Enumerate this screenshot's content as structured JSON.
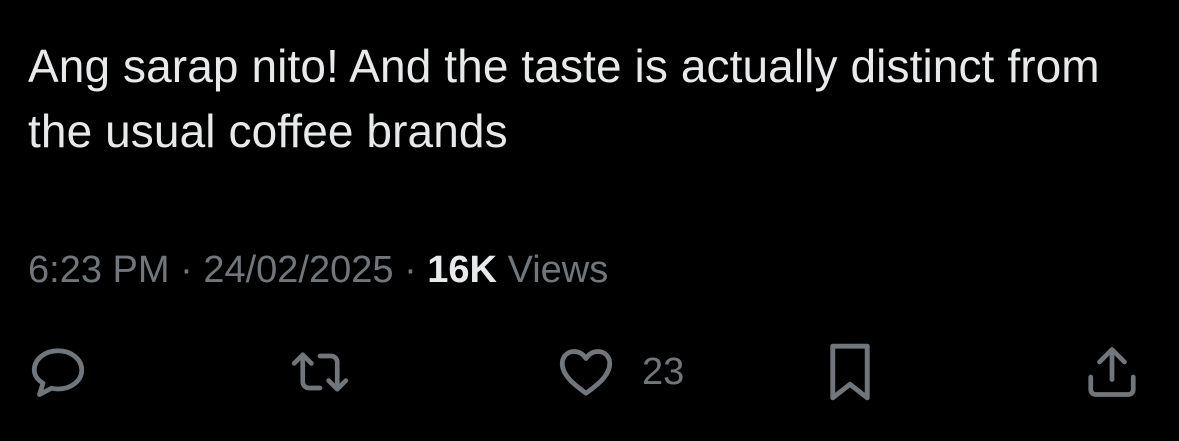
{
  "tweet": {
    "text": "Ang sarap nito! And the taste is actually distinct from the usual coffee brands",
    "time": "6:23 PM",
    "separator": "·",
    "date": "24/02/2025",
    "views_count": "16K",
    "views_label": "Views"
  },
  "actions": {
    "reply_icon": "reply-icon",
    "retweet_icon": "retweet-icon",
    "like_icon": "heart-icon",
    "like_count": "23",
    "bookmark_icon": "bookmark-icon",
    "share_icon": "share-icon"
  },
  "colors": {
    "background": "#000000",
    "text": "#e7e9ea",
    "secondary": "#71767b"
  }
}
